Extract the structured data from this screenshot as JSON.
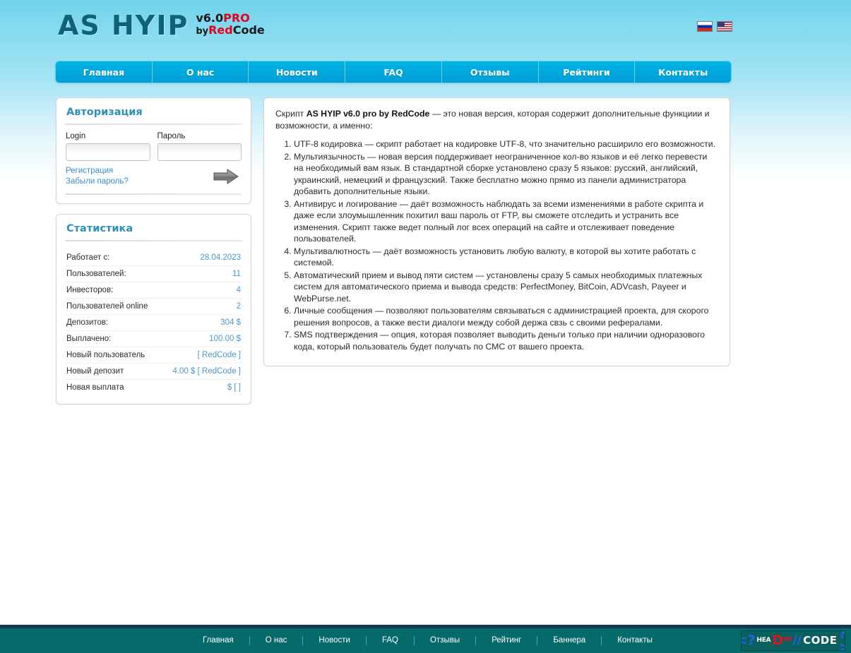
{
  "header": {
    "logo_main": "AS HYIP",
    "logo_line1_version": "v6.0",
    "logo_line1_pro": "PRO",
    "logo_line2_by": "by",
    "logo_line2_red": "Red",
    "logo_line2_code": "Code",
    "flags": [
      {
        "name": "flag-ru",
        "title": "Русский"
      },
      {
        "name": "flag-us",
        "title": "English"
      }
    ]
  },
  "nav": {
    "items": [
      {
        "label": "Главная"
      },
      {
        "label": "О нас"
      },
      {
        "label": "Новости"
      },
      {
        "label": "FAQ"
      },
      {
        "label": "Отзывы"
      },
      {
        "label": "Рейтинги"
      },
      {
        "label": "Контакты"
      }
    ]
  },
  "auth": {
    "title": "Авторизация",
    "login_label": "Login",
    "login_value": "",
    "password_label": "Пароль",
    "password_value": "",
    "register_link": "Регистрация",
    "forgot_link": "Забыли пароль?",
    "submit_icon": "arrow-right-icon"
  },
  "stats": {
    "title": "Статистика",
    "rows": [
      {
        "label": "Работает с:",
        "value": "28.04.2023"
      },
      {
        "label": "Пользователей:",
        "value": "11"
      },
      {
        "label": "Инвесторов:",
        "value": "4"
      },
      {
        "label": "Пользователей online",
        "value": "2"
      },
      {
        "label": "Депозитов:",
        "value": "304 $"
      },
      {
        "label": "Выплачено:",
        "value": "100.00 $"
      },
      {
        "label": "Новый пользователь",
        "value": "[ RedCode ]"
      },
      {
        "label": "Новый депозит",
        "value": "4.00 $ [ RedCode ]"
      },
      {
        "label": "Новая выплата",
        "value": "$ [ ]"
      }
    ]
  },
  "main": {
    "intro_prefix": "Скрипт ",
    "intro_bold": "AS HYIP v6.0 pro by RedCode",
    "intro_suffix": " — это новая версия,  которая содержит дополнительные функциии и возможности, а именно:",
    "features": [
      "UTF-8 кодировка — скрипт работает на кодировке UTF-8, что значительно расширило его возможности.",
      "Мультиязычность — новая версия поддерживает неограниченное кол-во языков и её легко перевести на необходимый вам язык. В стандартной сборке установлено сразу 5 языков: русский, английский, украинский, немецкий и французский. Также бесплатно можно прямо из панели администратора добавить дополнительные языки.",
      "Антивирус и логирование — даёт возможность наблюдать за всеми изменениями в работе скрипта и даже если злоумышленник похитил ваш пароль от FTP, вы сможете отследить и устранить все изменения. Скрипт также ведет полный лог всех операций на сайте и отслеживает поведение пользователей.",
      "Мультивалютность — даёт возможность установить любую валюту, в которой вы хотите работать с системой.",
      "Автоматический прием и вывод пяти систем — установлены сразу 5 самых необходимых платежных систем для автоматического приема и вывода средств: PerfectMoney, BitCoin, ADVcash, Payeer и WebPurse.net.",
      "Личные сообщения — позволяют пользователям связываться с администрацией проекта, для скорого решения вопросов, а также вести диалоги между собой держа свзь с своими рефералами.",
      "SMS подтверждения — опция, которая позволяет выводить деньги только при наличии одноразового кода, который пользователь будет получать по СМС от вашего проекта."
    ]
  },
  "footer": {
    "links": [
      {
        "label": "Главная"
      },
      {
        "label": "О нас"
      },
      {
        "label": "Новости"
      },
      {
        "label": "FAQ"
      },
      {
        "label": "Отзывы"
      },
      {
        "label": "Рейтинг"
      },
      {
        "label": "Баннера"
      },
      {
        "label": "Контакты"
      }
    ],
    "logo": {
      "open_tag": "<?",
      "hea": "HEA",
      "d": "D",
      "sup": "RE",
      "slashes": "//",
      "code": "CODE",
      "close_tag": "?>"
    }
  },
  "colors": {
    "nav_blue": "#00aedd",
    "panel_title": "#2e8fb8",
    "stat_value": "#4d96c9",
    "footer_teal": "#066a6a",
    "footer_border": "#13384f",
    "logo_teal": "#0d6377",
    "logo_red": "#e8001c"
  }
}
